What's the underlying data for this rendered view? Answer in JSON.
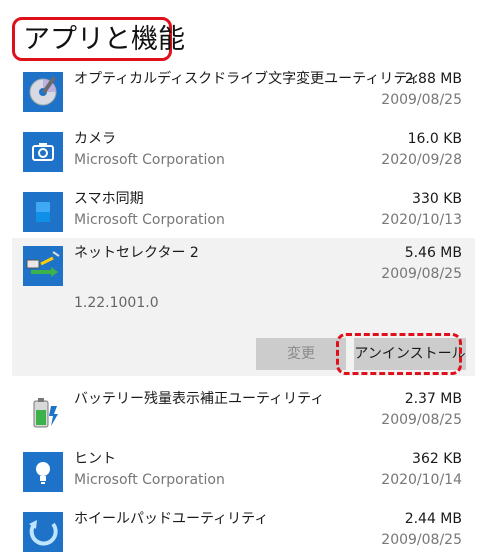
{
  "page": {
    "title": "アプリと機能"
  },
  "apps": [
    {
      "name": "オプティカルディスクドライブ文字変更ユーティリティ",
      "publisher": "",
      "size": "2.88 MB",
      "date": "2009/08/25",
      "icon": "optical-disc-icon"
    },
    {
      "name": "カメラ",
      "publisher": "Microsoft Corporation",
      "size": "16.0 KB",
      "date": "2020/09/28",
      "icon": "camera-icon"
    },
    {
      "name": "スマホ同期",
      "publisher": "Microsoft Corporation",
      "size": "330 KB",
      "date": "2020/10/13",
      "icon": "phone-sync-icon"
    },
    {
      "name": "ネットセレクター 2",
      "publisher": "",
      "size": "5.46 MB",
      "date": "2009/08/25",
      "version": "1.22.1001.0",
      "icon": "net-selector-icon",
      "selected": true
    },
    {
      "name": "バッテリー残量表示補正ユーティリティ",
      "publisher": "",
      "size": "2.37 MB",
      "date": "2009/08/25",
      "icon": "battery-icon"
    },
    {
      "name": "ヒント",
      "publisher": "Microsoft Corporation",
      "size": "362 KB",
      "date": "2020/10/14",
      "icon": "tips-lightbulb-icon"
    },
    {
      "name": "ホイールパッドユーティリティ",
      "publisher": "",
      "size": "2.44 MB",
      "date": "2009/08/25",
      "icon": "wheel-pad-icon"
    }
  ],
  "actions": {
    "modify_label": "変更",
    "uninstall_label": "アンインストール"
  },
  "colors": {
    "accent_blue": "#1e73c8",
    "highlight_red": "#e0101a",
    "selected_bg": "#f2f2f2"
  }
}
